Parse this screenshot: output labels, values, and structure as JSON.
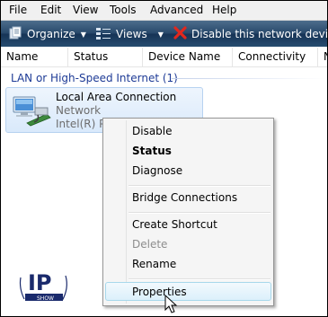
{
  "menubar": {
    "items": [
      "File",
      "Edit",
      "View",
      "Tools",
      "Advanced",
      "Help"
    ]
  },
  "toolbar": {
    "organize": "Organize",
    "views": "Views",
    "disable": "Disable this network device"
  },
  "columns": [
    "Name",
    "Status",
    "Device Name",
    "Connectivity",
    "N"
  ],
  "group": {
    "title": "LAN or High-Speed Internet (1)"
  },
  "item": {
    "name": "Local Area Connection",
    "status": "Network",
    "device": "Intel(R) PI"
  },
  "context_menu": {
    "items": [
      "Disable",
      "Status",
      "Diagnose",
      "Bridge Connections",
      "Create Shortcut",
      "Delete",
      "Rename",
      "Properties"
    ]
  },
  "logo": {
    "text": "IP",
    "subtext": "SHOW"
  }
}
